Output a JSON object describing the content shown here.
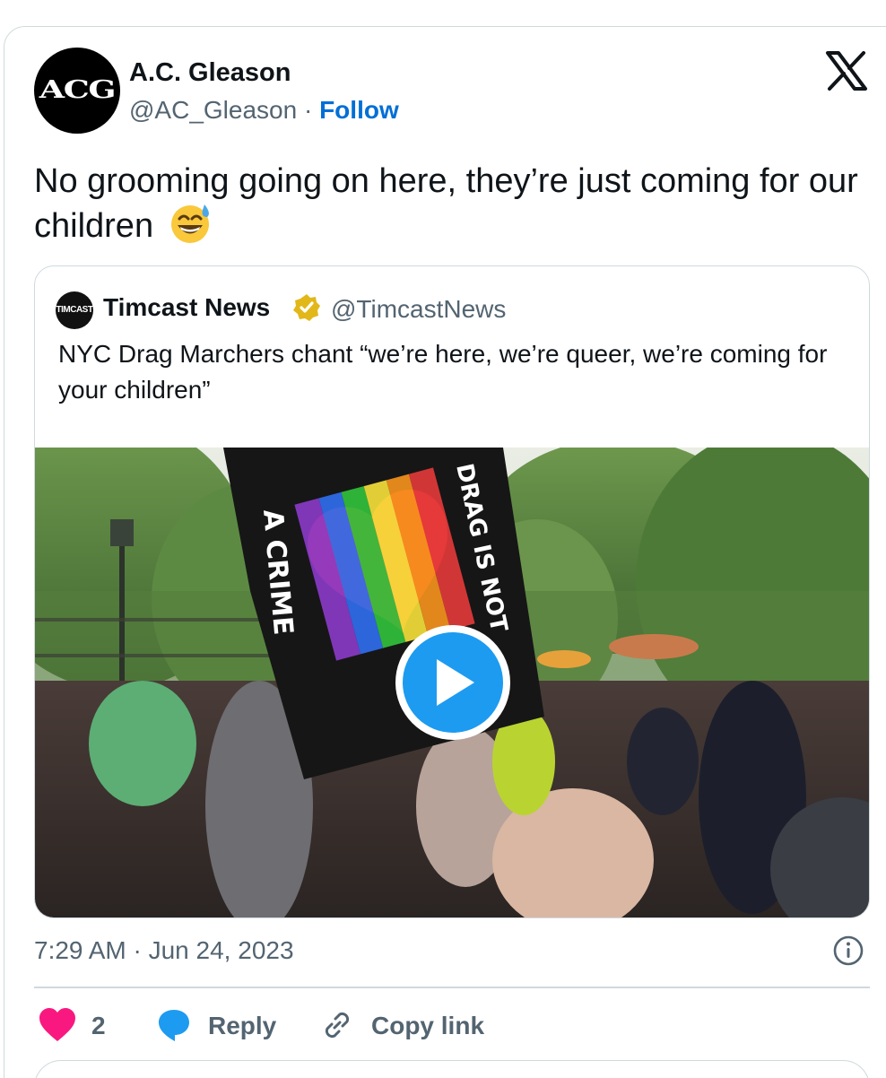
{
  "author": {
    "avatar_text": "ACG",
    "name": "A.C. Gleason",
    "handle": "@AC_Gleason",
    "separator": " · ",
    "follow_label": "Follow"
  },
  "tweet": {
    "text": "No grooming going on here, they’re just coming for our children",
    "emoji": "grinning-sweat-emoji"
  },
  "quote": {
    "avatar_text": "TIMCAST",
    "name": "Timcast News",
    "handle": "@TimcastNews",
    "verified": "gold-verified-badge",
    "text": "NYC Drag Marchers chant “we’re here, we’re queer, we’re coming for your children”",
    "media": {
      "type": "video",
      "flag_text_left": "A CRIME",
      "flag_text_right": "DRAG IS NOT"
    }
  },
  "meta": {
    "timestamp": "7:29 AM · Jun 24, 2023"
  },
  "actions": {
    "like_count": "2",
    "reply_label": "Reply",
    "copy_label": "Copy link"
  },
  "colors": {
    "accent": "#1d9bf0",
    "follow": "#006fd6",
    "like": "#f91880",
    "border": "#cfd9de",
    "secondary_text": "#536471"
  }
}
